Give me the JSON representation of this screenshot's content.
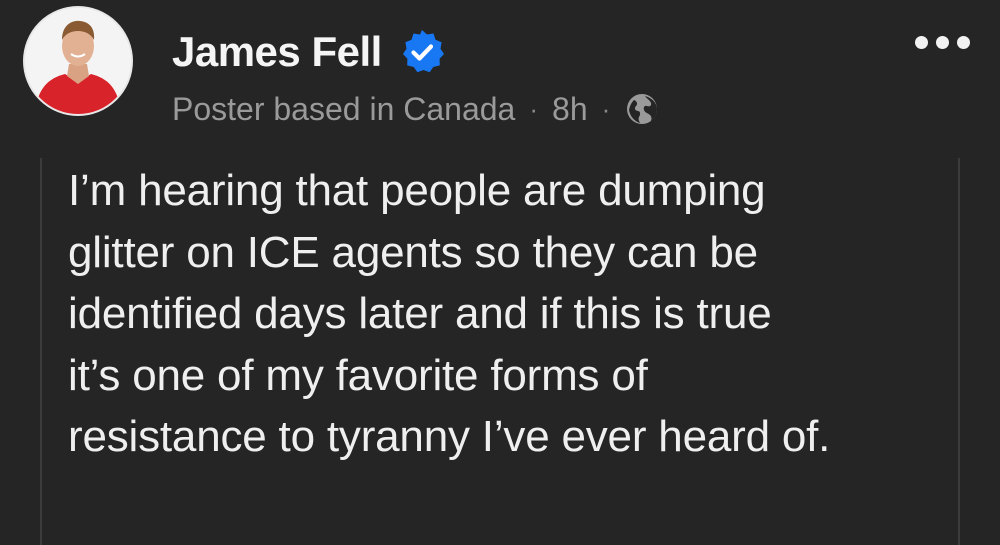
{
  "post": {
    "author": {
      "name": "James Fell",
      "verified": true
    },
    "meta": {
      "location": "Poster based in Canada",
      "separator": "·",
      "time": "8h",
      "audience_icon": "globe-icon"
    },
    "more_icon": "more-options-icon",
    "text": "I’m hearing that people are dumping\nglitter on ICE agents so they can be\nidentified days later and if this is true\nit’s one of my favorite forms of\nresistance to tyranny I’ve ever heard of."
  },
  "colors": {
    "background": "#252526",
    "verified_badge": "#1877f2",
    "name_text": "#f5f5f5",
    "meta_text": "#9a9a9a",
    "body_text": "#efefef",
    "avatar_shirt": "#d9232a"
  }
}
